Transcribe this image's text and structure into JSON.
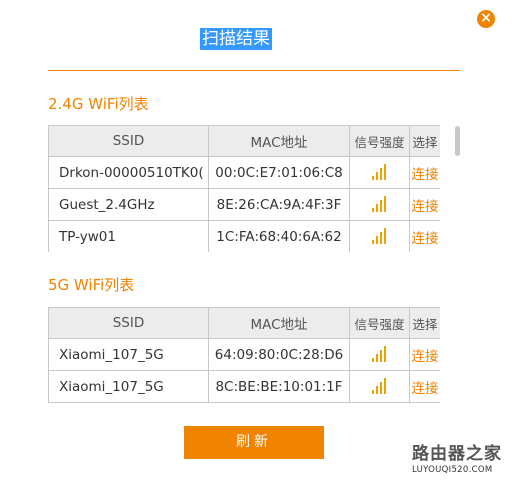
{
  "dialog": {
    "title": "扫描结果",
    "close_icon": "close-icon",
    "refresh_label": "刷新"
  },
  "columns": {
    "ssid": "SSID",
    "mac": "MAC地址",
    "signal": "信号强度",
    "action": "选择"
  },
  "wifi24": {
    "title": "2.4G WiFi列表",
    "rows": [
      {
        "ssid": "Drkon-00000510TK0(",
        "mac": "00:0C:E7:01:06:C8",
        "action": "连接",
        "signal_icon": "signal-bars-icon"
      },
      {
        "ssid": "Guest_2.4GHz",
        "mac": "8E:26:CA:9A:4F:3F",
        "action": "连接",
        "signal_icon": "signal-bars-icon"
      },
      {
        "ssid": "TP-yw01",
        "mac": "1C:FA:68:40:6A:62",
        "action": "连接",
        "signal_icon": "signal-bars-icon"
      }
    ]
  },
  "wifi5": {
    "title": "5G WiFi列表",
    "rows": [
      {
        "ssid": "Xiaomi_107_5G",
        "mac": "64:09:80:0C:28:D6",
        "action": "连接",
        "signal_icon": "signal-bars-icon"
      },
      {
        "ssid": "Xiaomi_107_5G",
        "mac": "8C:BE:BE:10:01:1F",
        "action": "连接",
        "signal_icon": "signal-bars-icon"
      }
    ]
  },
  "watermark": {
    "main": "路由器之家",
    "sub": "LUYOUQI520.COM"
  },
  "colors": {
    "accent": "#f08300",
    "title_highlight": "#3399ff",
    "signal": "#f0a000"
  }
}
